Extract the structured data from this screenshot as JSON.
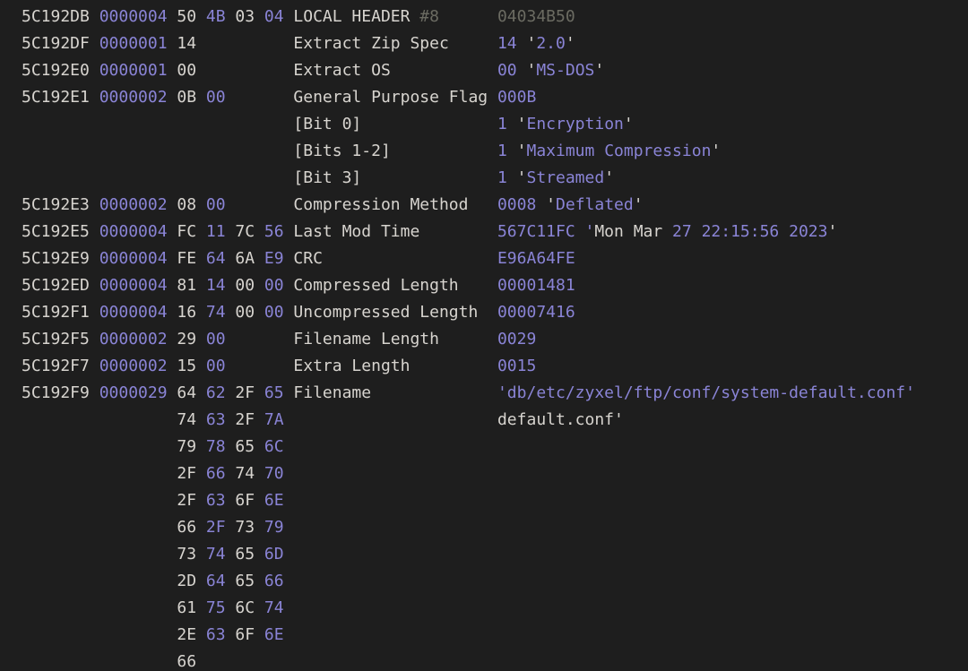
{
  "header": {
    "offset": "5C192DB",
    "length": "0000004",
    "hex": [
      "50",
      "4B",
      "03",
      "04"
    ],
    "label": "LOCAL HEADER ",
    "num": "#8",
    "value_alt": "04034B50"
  },
  "fields": [
    {
      "offset": "5C192DF",
      "length": "0000001",
      "hex": [
        "14"
      ],
      "desc": "Extract Zip Spec",
      "value": [
        [
          "14",
          " '"
        ],
        [
          "2.0"
        ],
        [
          "'"
        ]
      ]
    },
    {
      "offset": "5C192E0",
      "length": "0000001",
      "hex": [
        "00"
      ],
      "desc": "Extract OS",
      "value": [
        [
          "00",
          " '"
        ],
        [
          "MS-DOS"
        ],
        [
          "'"
        ]
      ]
    },
    {
      "offset": "5C192E1",
      "length": "0000002",
      "hex": [
        "0B",
        "00"
      ],
      "desc": "General Purpose Flag",
      "value": [
        [
          "000B"
        ]
      ],
      "sub": [
        {
          "desc": "[Bit  0]",
          "value": [
            [
              "1",
              " '"
            ],
            [
              "Encryption"
            ],
            [
              "'"
            ]
          ]
        },
        {
          "desc": "[Bits 1-2]",
          "value": [
            [
              "1",
              " '"
            ],
            [
              "Maximum Compression"
            ],
            [
              "'"
            ]
          ]
        },
        {
          "desc": "[Bit  3]",
          "value": [
            [
              "1",
              " '"
            ],
            [
              "Streamed"
            ],
            [
              "'"
            ]
          ]
        }
      ]
    },
    {
      "offset": "5C192E3",
      "length": "0000002",
      "hex": [
        "08",
        "00"
      ],
      "desc": "Compression Method",
      "value": [
        [
          "0008",
          " '"
        ],
        [
          "Deflated"
        ],
        [
          "'"
        ]
      ]
    },
    {
      "offset": "5C192E5",
      "length": "0000004",
      "hex": [
        "FC",
        "11",
        "7C",
        "56"
      ],
      "desc": "Last Mod Time",
      "value": [
        [
          "567C11FC '"
        ],
        [
          "Mon Mar "
        ],
        [
          "27",
          " "
        ],
        [
          "22:15:56",
          " "
        ],
        [
          "2023"
        ],
        [
          "'"
        ]
      ]
    },
    {
      "offset": "5C192E9",
      "length": "0000004",
      "hex": [
        "FE",
        "64",
        "6A",
        "E9"
      ],
      "desc": "CRC",
      "value": [
        [
          "E96A64FE"
        ]
      ]
    },
    {
      "offset": "5C192ED",
      "length": "0000004",
      "hex": [
        "81",
        "14",
        "00",
        "00"
      ],
      "desc": "Compressed Length",
      "value": [
        [
          "00001481"
        ]
      ]
    },
    {
      "offset": "5C192F1",
      "length": "0000004",
      "hex": [
        "16",
        "74",
        "00",
        "00"
      ],
      "desc": "Uncompressed Length",
      "value": [
        [
          "00007416"
        ]
      ]
    },
    {
      "offset": "5C192F5",
      "length": "0000002",
      "hex": [
        "29",
        "00"
      ],
      "desc": "Filename Length",
      "value": [
        [
          "0029"
        ]
      ]
    },
    {
      "offset": "5C192F7",
      "length": "0000002",
      "hex": [
        "15",
        "00"
      ],
      "desc": "Extra Length",
      "value": [
        [
          "0015"
        ]
      ]
    },
    {
      "offset": "5C192F9",
      "length": "0000029",
      "hex": [
        "64",
        "62",
        "2F",
        "65",
        "74",
        "63",
        "2F",
        "7A",
        "79",
        "78",
        "65",
        "6C",
        "2F",
        "66",
        "74",
        "70",
        "2F",
        "63",
        "6F",
        "6E",
        "66",
        "2F",
        "73",
        "79",
        "73",
        "74",
        "65",
        "6D",
        "2D",
        "64",
        "65",
        "66",
        "61",
        "75",
        "6C",
        "74",
        "2E",
        "63",
        "6F",
        "6E",
        "66"
      ],
      "desc": "Filename",
      "value": [
        [
          "'db/etc/zyxel/ftp/conf/system-default.conf'"
        ]
      ],
      "value_wraps": [
        "'db/etc/zyxel/ftp/conf/system-",
        "default.conf'"
      ]
    }
  ]
}
